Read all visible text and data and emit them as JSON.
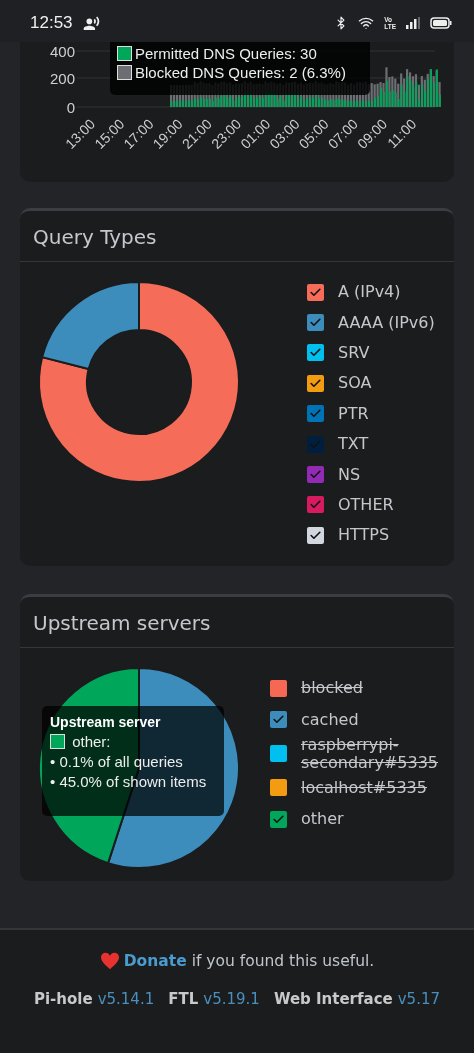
{
  "status_bar": {
    "time": "12:53",
    "volte_top": "Vo",
    "volte_bottom": "LTE"
  },
  "queries_chart": {
    "y_axis_labels": [
      "400",
      "200",
      "0"
    ],
    "x_axis_labels": [
      "13:00",
      "15:00",
      "17:00",
      "19:00",
      "21:00",
      "23:00",
      "01:00",
      "03:00",
      "05:00",
      "07:00",
      "09:00",
      "11:00"
    ],
    "tooltip": {
      "items": [
        {
          "label": "Permitted DNS Queries: 30",
          "color": "#00a65a"
        },
        {
          "label": "Blocked DNS Queries: 2 (6.3%)",
          "color": "#6b6e72"
        }
      ]
    }
  },
  "query_types": {
    "title": "Query Types",
    "chart_data": {
      "type": "donut",
      "values": [
        79,
        21,
        0,
        0,
        0,
        0,
        0,
        0,
        0
      ]
    },
    "legend": [
      {
        "label": "A (IPv4)",
        "color": "#f56c58",
        "checked": true
      },
      {
        "label": "AAAA (IPv6)",
        "color": "#3c8dbc",
        "checked": true
      },
      {
        "label": "SRV",
        "color": "#00c0ef",
        "checked": true
      },
      {
        "label": "SOA",
        "color": "#f39c12",
        "checked": true
      },
      {
        "label": "PTR",
        "color": "#0073b7",
        "checked": true
      },
      {
        "label": "TXT",
        "color": "#001f3f",
        "checked": true
      },
      {
        "label": "NS",
        "color": "#932ab6",
        "checked": true
      },
      {
        "label": "OTHER",
        "color": "#d81b60",
        "checked": true
      },
      {
        "label": "HTTPS",
        "color": "#d2d6de",
        "checked": true
      }
    ]
  },
  "upstream_servers": {
    "title": "Upstream servers",
    "chart_data": {
      "type": "pie",
      "values": [
        0,
        55,
        0,
        0,
        45
      ]
    },
    "tooltip": {
      "title": "Upstream server",
      "label": "other:",
      "color": "#00a65a",
      "lines": [
        "• 0.1% of all queries",
        "• 45.0% of shown items"
      ]
    },
    "legend": [
      {
        "label": "blocked",
        "color": "#f56954",
        "checked": false
      },
      {
        "label": "cached",
        "color": "#3c8dbc",
        "checked": true
      },
      {
        "label": "raspberrypi-secondary#5335",
        "color": "#00c0ef",
        "checked": false
      },
      {
        "label": "localhost#5335",
        "color": "#f39c12",
        "checked": false
      },
      {
        "label": "other",
        "color": "#00a65a",
        "checked": true
      }
    ]
  },
  "footer": {
    "donate_link": "Donate",
    "donate_text": "if you found this useful.",
    "versions": [
      {
        "name": "Pi-hole",
        "version": "v5.14.1"
      },
      {
        "name": "FTL",
        "version": "v5.19.1"
      },
      {
        "name": "Web Interface",
        "version": "v5.17"
      }
    ]
  }
}
